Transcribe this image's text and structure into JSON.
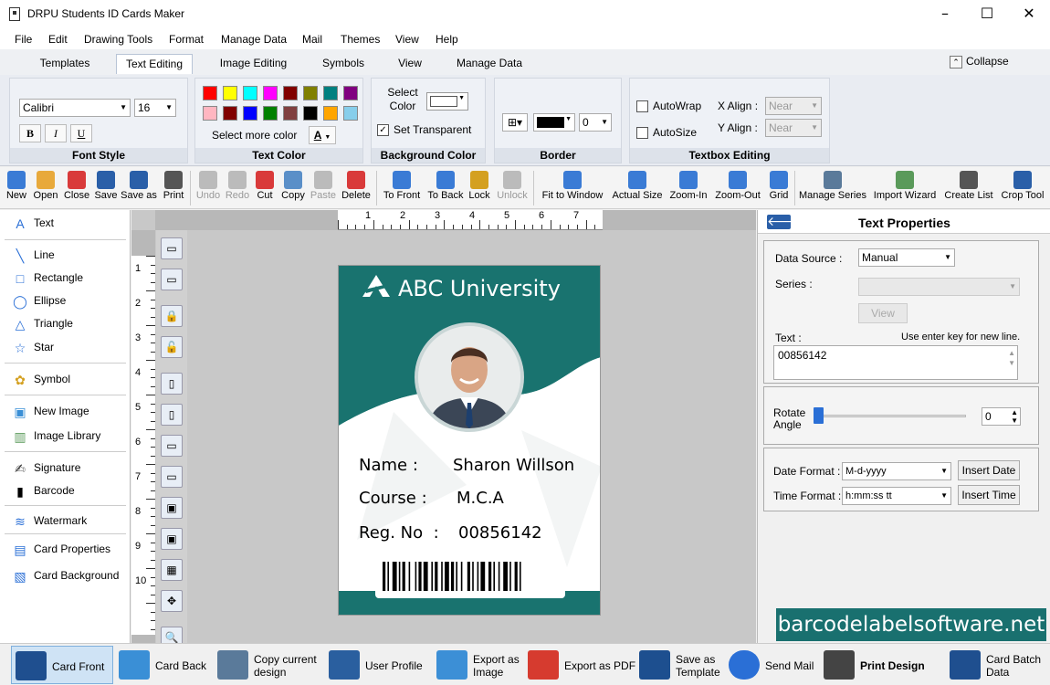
{
  "window": {
    "title": "DRPU Students ID Cards Maker",
    "minimize": "–",
    "maximize": "☐",
    "close": "✕"
  },
  "menu": [
    "File",
    "Edit",
    "Drawing Tools",
    "Format",
    "Manage Data",
    "Mail",
    "Themes",
    "View",
    "Help"
  ],
  "ribbon_tabs": [
    "Templates",
    "Text Editing",
    "Image Editing",
    "Symbols",
    "View",
    "Manage Data"
  ],
  "collapse_label": "Collapse",
  "ribbon": {
    "font_style": {
      "title": "Font Style",
      "font": "Calibri",
      "size": "16",
      "bold": "B",
      "italic": "I",
      "underline": "U"
    },
    "text_color": {
      "title": "Text Color",
      "more": "Select more color",
      "a_glyph": "A",
      "swatches": [
        "#ff0000",
        "#ffff00",
        "#00ffff",
        "#ff00ff",
        "#800000",
        "#808000",
        "#008080",
        "#800080",
        "#ffb6c1",
        "#800000",
        "#0000ff",
        "#008000",
        "#804040",
        "#000000",
        "#ffa500",
        "#87ceeb"
      ]
    },
    "background_color": {
      "title": "Background Color",
      "select_color": "Select Color",
      "set_transparent": "Set Transparent"
    },
    "border": {
      "title": "Border",
      "width": "0"
    },
    "textbox_editing": {
      "title": "Textbox Editing",
      "autowrap": "AutoWrap",
      "autosize": "AutoSize",
      "x_align_label": "X Align :",
      "x_align": "Near",
      "y_align_label": "Y Align :",
      "y_align": "Near"
    }
  },
  "toolbar": [
    "New",
    "Open",
    "Close",
    "Save",
    "Save as",
    "Print",
    "Undo",
    "Redo",
    "Cut",
    "Copy",
    "Paste",
    "Delete",
    "To Front",
    "To Back",
    "Lock",
    "Unlock",
    "Fit to Window",
    "Actual Size",
    "Zoom-In",
    "Zoom-Out",
    "Grid",
    "Manage Series",
    "Import Wizard",
    "Create List",
    "Crop Tool"
  ],
  "left_panel": [
    "Text",
    "Line",
    "Rectangle",
    "Ellipse",
    "Triangle",
    "Star",
    "Symbol",
    "New Image",
    "Image Library",
    "Signature",
    "Barcode",
    "Watermark",
    "Card Properties",
    "Card Background"
  ],
  "ruler_top": [
    "1",
    "2",
    "3",
    "4",
    "5",
    "6",
    "7"
  ],
  "ruler_left": [
    "1",
    "2",
    "3",
    "4",
    "5",
    "6",
    "7",
    "8",
    "9",
    "10"
  ],
  "card": {
    "university": "ABC University",
    "fields": [
      {
        "label": "Name :",
        "value": "Sharon Willson"
      },
      {
        "label": "Course :",
        "value": "M.C.A"
      },
      {
        "label": "Reg. No  :",
        "value": "00856142"
      }
    ],
    "colors": {
      "teal": "#19736f"
    }
  },
  "text_properties": {
    "title": "Text Properties",
    "data_source_label": "Data Source :",
    "data_source": "Manual",
    "series_label": "Series :",
    "view": "View",
    "text_label": "Text :",
    "hint": "Use enter key for new line.",
    "text_value": "00856142",
    "rotate_label": "Rotate Angle",
    "rotate_value": "0",
    "date_format_label": "Date Format :",
    "date_format": "M-d-yyyy",
    "insert_date": "Insert Date",
    "time_format_label": "Time Format :",
    "time_format": "h:mm:ss tt",
    "insert_time": "Insert Time"
  },
  "bottom_bar": {
    "card_front": "Card Front",
    "card_back": "Card Back",
    "copy_design_1": "Copy current",
    "copy_design_2": "design",
    "user_profile": "User Profile",
    "export_image_1": "Export as",
    "export_image_2": "Image",
    "export_pdf": "Export as PDF",
    "save_template_1": "Save as",
    "save_template_2": "Template",
    "send_mail": "Send Mail",
    "print_design": "Print Design",
    "batch_1": "Card Batch",
    "batch_2": "Data"
  },
  "watermark": "barcodelabelsoftware.net"
}
